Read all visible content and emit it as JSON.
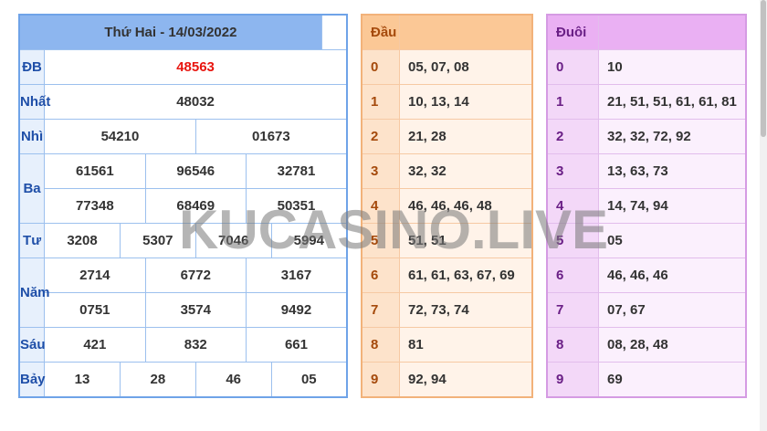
{
  "results": {
    "title": "Thứ Hai - 14/03/2022",
    "rows": [
      {
        "label": "ĐB",
        "values": [
          "48563"
        ]
      },
      {
        "label": "Nhất",
        "values": [
          "48032"
        ]
      },
      {
        "label": "Nhì",
        "values": [
          "54210",
          "01673"
        ]
      },
      {
        "label": "Ba",
        "values": [
          "61561",
          "96546",
          "32781",
          "77348",
          "68469",
          "50351"
        ]
      },
      {
        "label": "Tư",
        "values": [
          "3208",
          "5307",
          "7046",
          "5994"
        ]
      },
      {
        "label": "Năm",
        "values": [
          "2714",
          "6772",
          "3167",
          "0751",
          "3574",
          "9492"
        ]
      },
      {
        "label": "Sáu",
        "values": [
          "421",
          "832",
          "661"
        ]
      },
      {
        "label": "Bảy",
        "values": [
          "13",
          "28",
          "46",
          "05"
        ]
      }
    ]
  },
  "dau": {
    "header": "Đầu",
    "rows": [
      {
        "key": "0",
        "value": "05, 07, 08"
      },
      {
        "key": "1",
        "value": "10, 13, 14"
      },
      {
        "key": "2",
        "value": "21, 28"
      },
      {
        "key": "3",
        "value": "32, 32"
      },
      {
        "key": "4",
        "value": "46, 46, 46, 48"
      },
      {
        "key": "5",
        "value": "51, 51"
      },
      {
        "key": "6",
        "value": "61, 61, 63, 67, 69"
      },
      {
        "key": "7",
        "value": "72, 73, 74"
      },
      {
        "key": "8",
        "value": "81"
      },
      {
        "key": "9",
        "value": "92, 94"
      }
    ]
  },
  "duoi": {
    "header": "Đuôi",
    "rows": [
      {
        "key": "0",
        "value": "10"
      },
      {
        "key": "1",
        "value": "21, 51, 51, 61, 61, 81"
      },
      {
        "key": "2",
        "value": "32, 32, 72, 92"
      },
      {
        "key": "3",
        "value": "13, 63, 73"
      },
      {
        "key": "4",
        "value": "14, 74, 94"
      },
      {
        "key": "5",
        "value": "05"
      },
      {
        "key": "6",
        "value": "46, 46, 46"
      },
      {
        "key": "7",
        "value": "07, 67"
      },
      {
        "key": "8",
        "value": "08, 28, 48"
      },
      {
        "key": "9",
        "value": "69"
      }
    ]
  },
  "watermark": "KUCASINO.LIVE",
  "colors": {
    "special_prize": "#e8150f",
    "results_border": "#6fa3e8",
    "dau_border": "#f2b27a",
    "duoi_border": "#d59be3"
  }
}
